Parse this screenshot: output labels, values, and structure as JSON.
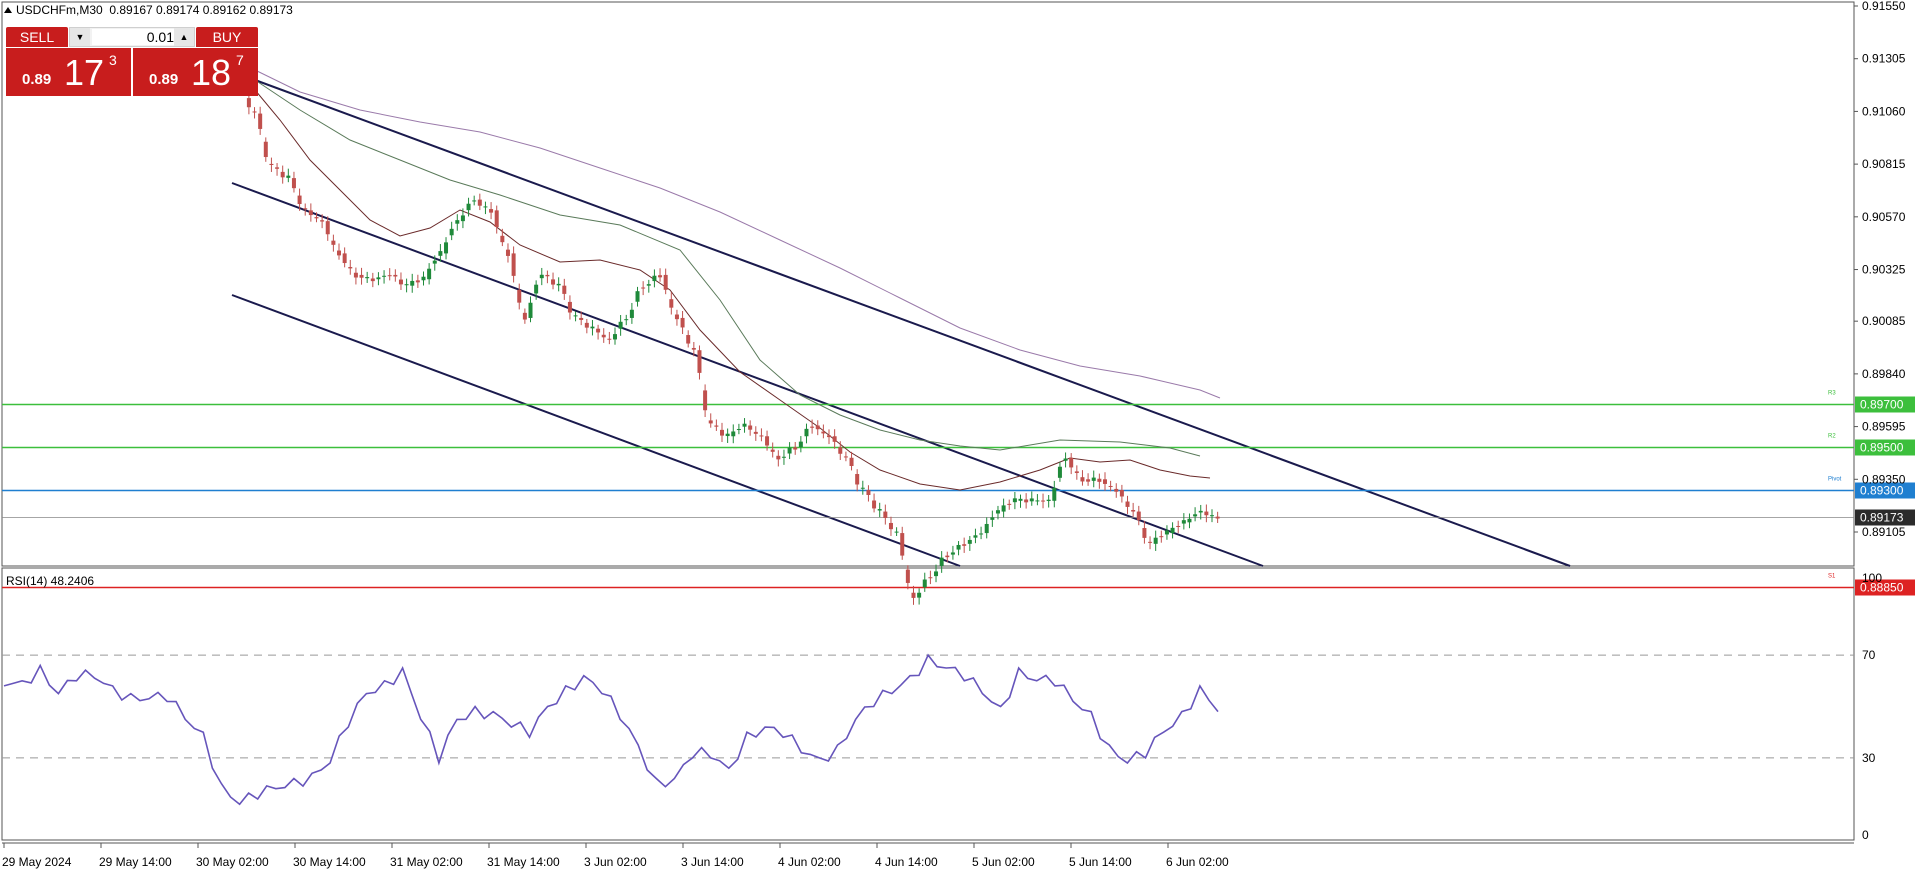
{
  "header": {
    "symbol": "USDCHFm,M30",
    "ohlc": "0.89167 0.89174 0.89162 0.89173"
  },
  "trade_panel": {
    "sell_label": "SELL",
    "buy_label": "BUY",
    "lot_value": "0.01",
    "sell_price": {
      "prefix": "0.89",
      "big": "17",
      "sup": "3"
    },
    "buy_price": {
      "prefix": "0.89",
      "big": "18",
      "sup": "7"
    }
  },
  "price_axis": [
    "0.91550",
    "0.91305",
    "0.91060",
    "0.90815",
    "0.90570",
    "0.90325",
    "0.90085",
    "0.89840",
    "0.89595",
    "0.89350",
    "0.89105"
  ],
  "levels": [
    {
      "name": "level-r3",
      "price": 0.897,
      "label": "0.89700",
      "color": "#3cbf3c",
      "tag": "R3"
    },
    {
      "name": "level-r2",
      "price": 0.895,
      "label": "0.89500",
      "color": "#3cbf3c",
      "tag": "R2"
    },
    {
      "name": "level-pivot",
      "price": 0.893,
      "label": "0.89300",
      "color": "#1f7fd0",
      "tag": "Pivot"
    },
    {
      "name": "level-current",
      "price": 0.89173,
      "label": "0.89173",
      "color": "#2b2b2b",
      "tag": ""
    },
    {
      "name": "level-s1",
      "price": 0.8885,
      "label": "0.88850",
      "color": "#dd2222",
      "tag": "S1"
    }
  ],
  "time_axis": [
    "29 May 2024",
    "29 May 14:00",
    "30 May 02:00",
    "30 May 14:00",
    "31 May 02:00",
    "31 May 14:00",
    "3 Jun 02:00",
    "3 Jun 14:00",
    "4 Jun 02:00",
    "4 Jun 14:00",
    "5 Jun 02:00",
    "5 Jun 14:00",
    "6 Jun 02:00"
  ],
  "rsi": {
    "label": "RSI(14) 48.2406",
    "axis": [
      "100",
      "70",
      "30",
      "0"
    ],
    "levels": [
      70,
      30
    ],
    "color": "#6655bb"
  },
  "colors": {
    "bull": "#1f8a3a",
    "bear": "#c0504d",
    "channel": "#1a1a4d",
    "ma_fast": "#5a1a1a",
    "ma_mid": "#3a5a3a",
    "ma_slow": "#7a5a8a"
  },
  "chart_data": {
    "type": "candlestick",
    "symbol": "USDCHFm",
    "timeframe": "M30",
    "y_range": [
      0.888,
      0.9158
    ],
    "close_series_approx": [
      0.912,
      0.9105,
      0.908,
      0.9075,
      0.906,
      0.9055,
      0.904,
      0.903,
      0.9028,
      0.903,
      0.9025,
      0.9028,
      0.904,
      0.9055,
      0.9065,
      0.906,
      0.904,
      0.901,
      0.903,
      0.9025,
      0.901,
      0.9005,
      0.9,
      0.901,
      0.9025,
      0.903,
      0.901,
      0.8995,
      0.896,
      0.8955,
      0.896,
      0.8955,
      0.8945,
      0.895,
      0.896,
      0.8955,
      0.8945,
      0.893,
      0.892,
      0.891,
      0.888,
      0.889,
      0.89,
      0.8905,
      0.891,
      0.892,
      0.8925,
      0.8925,
      0.8925,
      0.8945,
      0.8935,
      0.8935,
      0.893,
      0.892,
      0.8905,
      0.891,
      0.8915,
      0.892,
      0.89173
    ],
    "rsi_series_approx": [
      58,
      60,
      66,
      55,
      60,
      61,
      58,
      55,
      53,
      52,
      45,
      40,
      20,
      12,
      14,
      18,
      22,
      24,
      28,
      42,
      55,
      60,
      65,
      45,
      28,
      45,
      50,
      48,
      42,
      38,
      50,
      58,
      62,
      55,
      45,
      35,
      22,
      22,
      30,
      30,
      26,
      40,
      42,
      38,
      32,
      30,
      35,
      45,
      50,
      55,
      62,
      70,
      65,
      60,
      55,
      50,
      65,
      60,
      58,
      52,
      48,
      35,
      28,
      30,
      40,
      48,
      58,
      48
    ]
  }
}
